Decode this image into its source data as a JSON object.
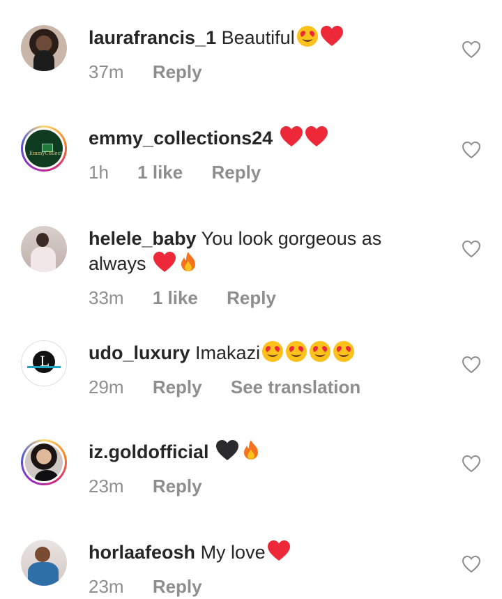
{
  "comments": [
    {
      "username": "laurafrancis_1",
      "text": "Beautiful",
      "emojis": [
        "heart-eyes",
        "red-heart"
      ],
      "time": "37m",
      "likes": "",
      "reply": "Reply",
      "extra": ""
    },
    {
      "username": "emmy_collections24",
      "text": "",
      "emojis": [
        "red-heart",
        "red-heart"
      ],
      "time": "1h",
      "likes": "1 like",
      "reply": "Reply",
      "extra": ""
    },
    {
      "username": "helele_baby",
      "text": "You look gorgeous as always",
      "emojis": [
        "red-heart",
        "fire"
      ],
      "time": "33m",
      "likes": "1 like",
      "reply": "Reply",
      "extra": ""
    },
    {
      "username": "udo_luxury",
      "text": "Imakazi",
      "emojis": [
        "heart-eyes",
        "heart-eyes",
        "heart-eyes",
        "heart-eyes"
      ],
      "time": "29m",
      "likes": "",
      "reply": "Reply",
      "extra": "See translation"
    },
    {
      "username": "iz.goldofficial",
      "text": "",
      "emojis": [
        "black-heart",
        "fire"
      ],
      "time": "23m",
      "likes": "",
      "reply": "Reply",
      "extra": ""
    },
    {
      "username": "horlaafeosh",
      "text": "My love",
      "emojis": [
        "red-heart"
      ],
      "time": "23m",
      "likes": "",
      "reply": "Reply",
      "extra": ""
    }
  ],
  "colors": {
    "text": "#262626",
    "muted": "#8e8e8e",
    "heart": "#ed2939"
  },
  "avatars": {
    "emmy_logo_text": "EmmyCollection"
  }
}
